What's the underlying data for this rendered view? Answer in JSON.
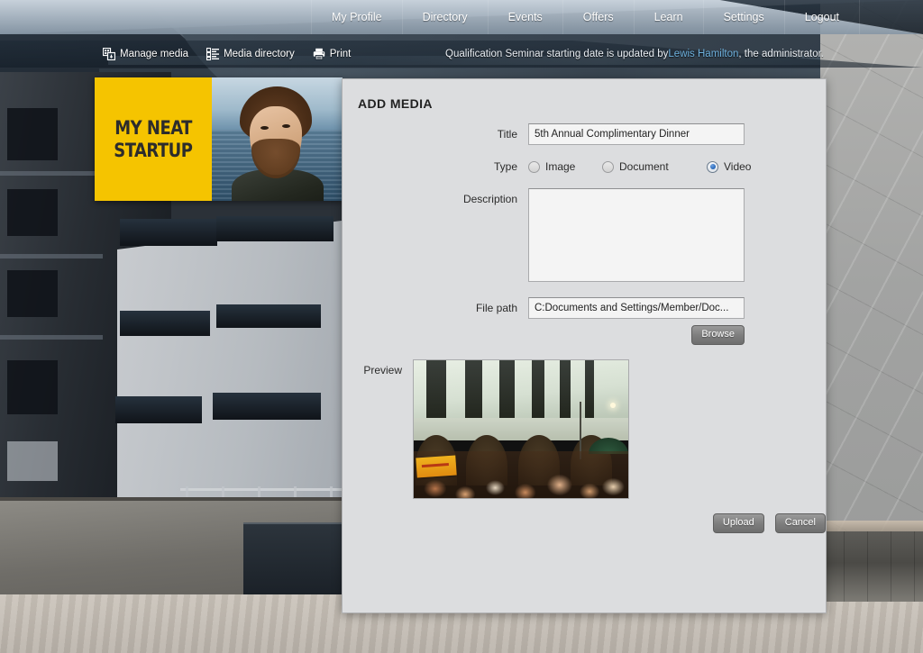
{
  "topnav": {
    "items": [
      {
        "label": "My Profile",
        "name": "nav-my-profile"
      },
      {
        "label": "Directory",
        "name": "nav-directory"
      },
      {
        "label": "Events",
        "name": "nav-events"
      },
      {
        "label": "Offers",
        "name": "nav-offers"
      },
      {
        "label": "Learn",
        "name": "nav-learn"
      },
      {
        "label": "Settings",
        "name": "nav-settings"
      },
      {
        "label": "Logout",
        "name": "nav-logout"
      }
    ]
  },
  "toolbar": {
    "manage_media": "Manage media",
    "media_directory": "Media directory",
    "print": "Print",
    "icons": [
      "manage-media-icon",
      "media-directory-icon",
      "print-icon"
    ]
  },
  "status": {
    "text_before": "Qualification Seminar starting date is updated by ",
    "link": "Lewis Hamilton",
    "text_after": ", the administrator."
  },
  "billboard": {
    "line1": "MY NEAT",
    "line2": "STARTUP",
    "bg_color": "#f5c400",
    "text_color": "#2c2c2c"
  },
  "modal": {
    "title": "ADD MEDIA",
    "fields": {
      "title_label": "Title",
      "title_value": "5th Annual Complimentary Dinner",
      "title_placeholder": "Title",
      "type_label": "Type",
      "type_options": [
        {
          "label": "Image",
          "selected": false
        },
        {
          "label": "Document",
          "selected": false
        },
        {
          "label": "Video",
          "selected": true
        }
      ],
      "description_label": "Description",
      "description_value": "",
      "description_placeholder": "",
      "filepath_label": "File path",
      "filepath_value": "C:Documents and Settings/Member/Doc...",
      "filepath_placeholder": "File path",
      "browse_label": "Browse",
      "preview_label": "Preview"
    },
    "buttons": {
      "upload": "Upload",
      "cancel": "Cancel"
    },
    "accent_color": "#2f6fbf",
    "panel_color": "#dcdddf"
  }
}
